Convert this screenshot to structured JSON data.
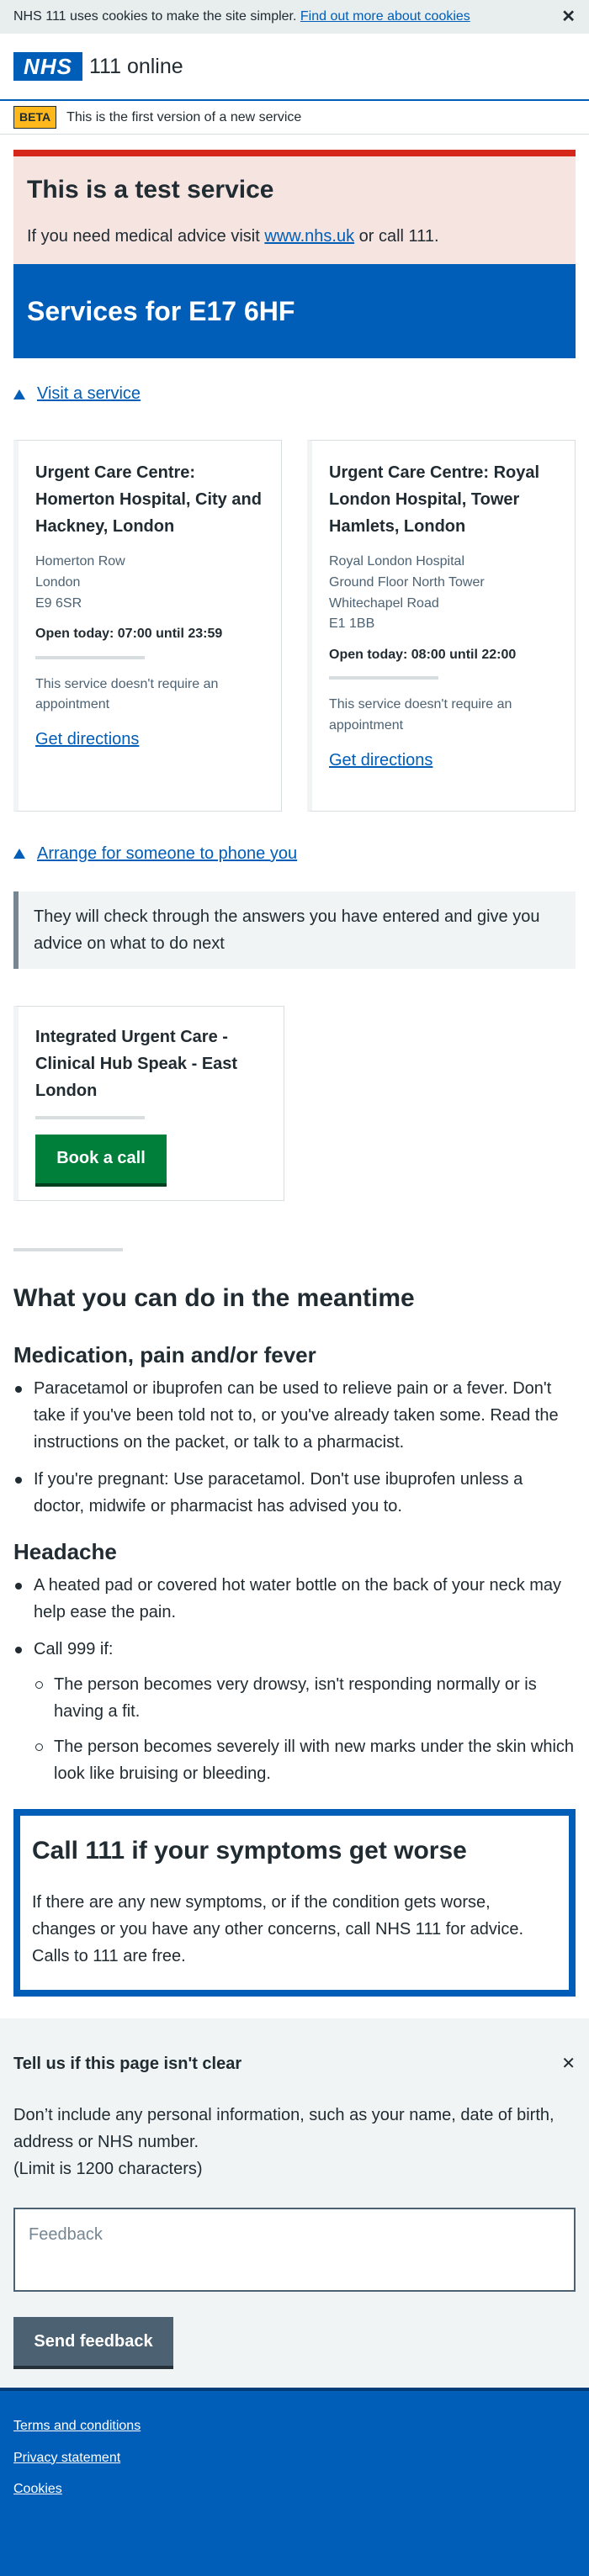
{
  "cookie_banner": {
    "text": "NHS 111 uses cookies to make the site simpler.",
    "link": "Find out more about cookies",
    "close": "✕"
  },
  "header": {
    "logo": "NHS",
    "service": "111 online"
  },
  "beta": {
    "tag": "BETA",
    "text": "This is the first version of a new service"
  },
  "test_service": {
    "title": "This is a test service",
    "text_before": "If you need medical advice visit ",
    "link": "www.nhs.uk",
    "text_after": " or call 111."
  },
  "hero": {
    "title": "Services for E17 6HF"
  },
  "visit_link": "Visit a service",
  "services": [
    {
      "name": "Urgent Care Centre: Homerton Hospital, City and Hackney, London",
      "address": [
        "Homerton Row",
        "London",
        "E9 6SR"
      ],
      "open": "Open today: 07:00 until 23:59",
      "note": "This service doesn't require an appointment",
      "directions": "Get directions"
    },
    {
      "name": "Urgent Care Centre: Royal London Hospital, Tower Hamlets, London",
      "address": [
        "Royal London Hospital",
        "Ground Floor North Tower",
        "Whitechapel Road",
        "E1 1BB"
      ],
      "open": "Open today: 08:00 until 22:00",
      "note": "This service doesn't require an appointment",
      "directions": "Get directions"
    }
  ],
  "phone_link": "Arrange for someone to phone you",
  "phone_inset": "They will check through the answers you have entered and give you advice on what to do next",
  "call_card": {
    "name": "Integrated Urgent Care - Clinical Hub Speak - East London",
    "button": "Book a call"
  },
  "meantime": {
    "title": "What you can do in the meantime",
    "medication": {
      "title": "Medication, pain and/or fever",
      "items": [
        "Paracetamol or ibuprofen can be used to relieve pain or a fever. Don't take if you've been told not to, or you've already taken some. Read the instructions on the packet, or talk to a pharmacist.",
        "If you're pregnant: Use paracetamol. Don't use ibuprofen unless a doctor, midwife or pharmacist has advised you to."
      ]
    },
    "headache": {
      "title": "Headache",
      "items": [
        "A heated pad or covered hot water bottle on the back of your neck may help ease the pain.",
        "Call 999 if:"
      ],
      "sub_items": [
        "The person becomes very drowsy, isn't responding normally or is having a fit.",
        "The person becomes severely ill with new marks under the skin which look like bruising or bleeding."
      ]
    }
  },
  "care_card": {
    "title": "Call 111 if your symptoms get worse",
    "text": "If there are any new symptoms, or if the condition gets worse, changes or you have any other concerns, call NHS 111 for advice. Calls to 111 are free."
  },
  "feedback": {
    "title": "Tell us if this page isn't clear",
    "close": "✕",
    "text": "Don’t include any personal information, such as your name, date of birth, address or NHS number.",
    "limit": "(Limit is 1200 characters)",
    "placeholder": "Feedback",
    "button": "Send feedback"
  },
  "footer": {
    "links": [
      "Terms and conditions",
      "Privacy statement",
      "Cookies"
    ]
  }
}
